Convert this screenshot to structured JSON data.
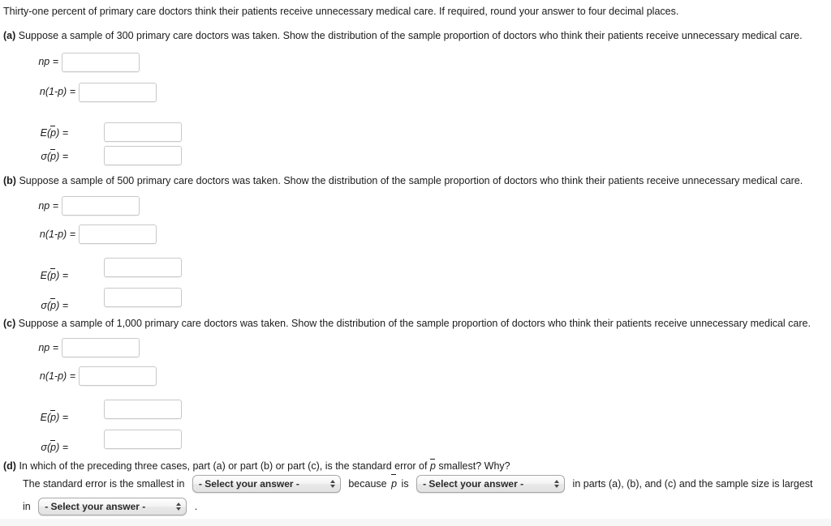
{
  "intro": "Thirty-one percent of primary care doctors think their patients receive unnecessary medical care. If required, round your answer to four decimal places.",
  "parts": [
    {
      "tag": "(a)",
      "text": "Suppose a sample of 300 primary care doctors was taken. Show the distribution of the sample proportion of doctors who think their patients receive unnecessary medical care.",
      "fields": [
        {
          "label": "np =",
          "value": ""
        },
        {
          "label": "n(1-p) =",
          "value": ""
        },
        {
          "label": "E(p) =",
          "value": ""
        },
        {
          "label": "σ(p) =",
          "value": ""
        }
      ]
    },
    {
      "tag": "(b)",
      "text": "Suppose a sample of 500 primary care doctors was taken. Show the distribution of the sample proportion of doctors who think their patients receive unnecessary medical care.",
      "fields": [
        {
          "label": "np =",
          "value": ""
        },
        {
          "label": "n(1-p) =",
          "value": ""
        },
        {
          "label": "E(p) =",
          "value": ""
        },
        {
          "label": "σ(p) =",
          "value": ""
        }
      ]
    },
    {
      "tag": "(c)",
      "text": "Suppose a sample of 1,000 primary care doctors was taken. Show the distribution of the sample proportion of doctors who think their patients receive unnecessary medical care.",
      "fields": [
        {
          "label": "np =",
          "value": ""
        },
        {
          "label": "n(1-p) =",
          "value": ""
        },
        {
          "label": "E(p) =",
          "value": ""
        },
        {
          "label": "σ(p) =",
          "value": ""
        }
      ]
    }
  ],
  "part_d": {
    "tag": "(d)",
    "question_pre": "In which of the preceding three cases, part (a) or part (b) or part (c), is the standard error of",
    "question_post": "smallest? Why?",
    "sentence_1": "The standard error is the smallest in",
    "sentence_2": "because",
    "sentence_3": "is",
    "sentence_4": "in parts (a), (b), and (c) and the sample size is largest",
    "sentence_5": "in",
    "sentence_6": ".",
    "selects": [
      {
        "label": "- Select your answer -"
      },
      {
        "label": "- Select your answer -"
      },
      {
        "label": "- Select your answer -"
      }
    ]
  },
  "symbols": {
    "p_bar": "p",
    "sigma": "σ"
  }
}
